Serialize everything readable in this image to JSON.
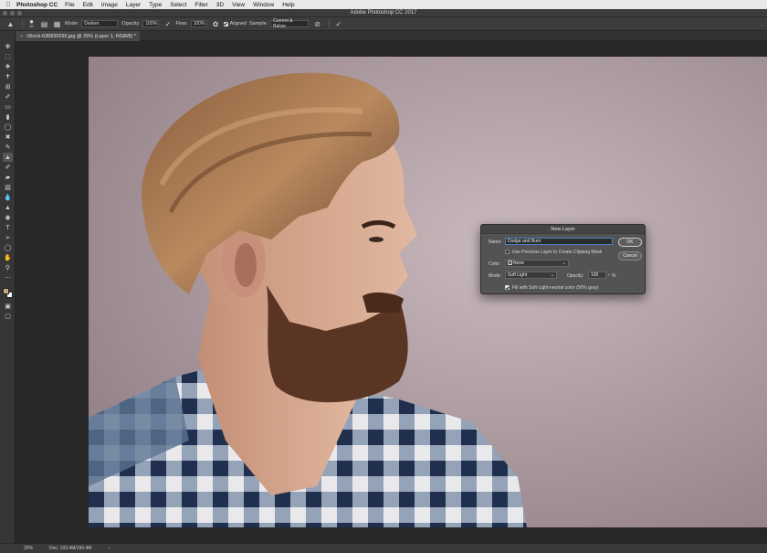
{
  "menubar": {
    "app_name": "Photoshop CC",
    "items": [
      "File",
      "Edit",
      "Image",
      "Layer",
      "Type",
      "Select",
      "Filter",
      "3D",
      "View",
      "Window",
      "Help"
    ]
  },
  "window": {
    "title": "Adobe Photoshop CC 2017"
  },
  "options": {
    "brush_size": "30",
    "mode_label": "Mode:",
    "mode_value": "Darken",
    "opacity_label": "Opacity:",
    "opacity_value": "100%",
    "flow_label": "Flow:",
    "flow_value": "100%",
    "aligned_label": "Aligned",
    "sample_label": "Sample:",
    "sample_value": "Current & Below"
  },
  "document": {
    "tab_label": "iStock-636830292.jpg @ 25% (Layer 1, RGB/8) *"
  },
  "status": {
    "zoom": "25%",
    "doc_size": "Doc: 103.4M/190.4M"
  },
  "dialog": {
    "title": "New Layer",
    "name_label": "Name:",
    "name_value": "Dodge and Burn",
    "clip_label": "Use Previous Layer to Create Clipping Mask",
    "color_label": "Color:",
    "color_value": "None",
    "mode_label": "Mode:",
    "mode_value": "Soft Light",
    "opacity_label": "Opacity:",
    "opacity_value": "100",
    "opacity_unit": "%",
    "fill_label": "Fill with Soft-Light-neutral color (50% gray)",
    "ok_label": "OK",
    "cancel_label": "Cancel"
  },
  "colors": {
    "background": "#b39fa4",
    "foreground_swatch": "#c9a88a",
    "background_swatch": "#ffffff"
  }
}
